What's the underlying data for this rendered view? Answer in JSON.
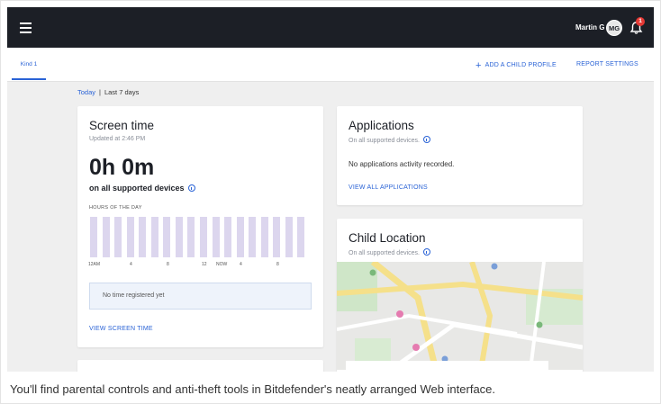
{
  "header": {
    "user_name": "Martin G",
    "avatar_initials": "MG",
    "notification_count": "1"
  },
  "subnav": {
    "profile_tab": "Kind 1",
    "add_child_label": "ADD A CHILD PROFILE",
    "report_settings_label": "REPORT SETTINGS"
  },
  "period": {
    "today": "Today",
    "separator": "|",
    "last7": "Last 7 days"
  },
  "screen_time": {
    "title": "Screen time",
    "updated": "Updated at 2:46 PM",
    "value": "0h 0m",
    "on_devices": "on all supported devices",
    "hours_label": "HOURS OF THE DAY",
    "ticks": [
      "12AM",
      "4",
      "8",
      "12",
      "NOW",
      "4",
      "8"
    ],
    "bar_count": 18,
    "empty_message": "No time registered yet",
    "view_link": "VIEW SCREEN TIME"
  },
  "applications": {
    "title": "Applications",
    "subtitle": "On all supported devices.",
    "empty_message": "No applications activity recorded.",
    "view_link": "VIEW ALL APPLICATIONS"
  },
  "child_location": {
    "title": "Child Location",
    "subtitle": "On all supported devices."
  },
  "caption": "You'll find parental controls and anti-theft tools in Bitdefender's neatly arranged Web interface.",
  "colors": {
    "topbar": "#1c1f26",
    "accent": "#2a63d6",
    "bar": "#dcd6ee",
    "badge": "#e53935"
  }
}
